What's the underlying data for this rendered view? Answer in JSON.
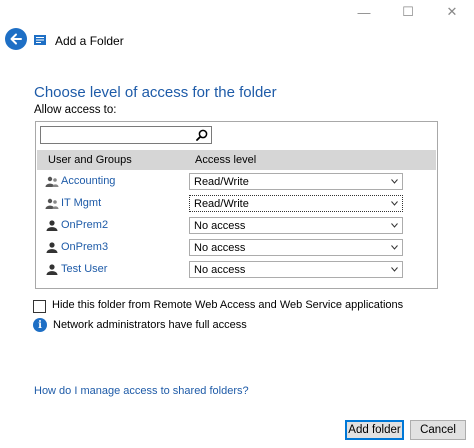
{
  "window": {
    "title": "Add a Folder",
    "controls": {
      "minimize": "—",
      "maximize": "☐",
      "close": "✕"
    }
  },
  "page": {
    "heading": "Choose level of access for the folder",
    "allow_label": "Allow access to:"
  },
  "search": {
    "value": "",
    "placeholder": ""
  },
  "table": {
    "columns": [
      "User and Groups",
      "Access level"
    ],
    "rows": [
      {
        "name": "Accounting",
        "kind": "group",
        "access": "Read/Write"
      },
      {
        "name": "IT Mgmt",
        "kind": "group",
        "access": "Read/Write"
      },
      {
        "name": "OnPrem2",
        "kind": "user",
        "access": "No access"
      },
      {
        "name": "OnPrem3",
        "kind": "user",
        "access": "No access"
      },
      {
        "name": "Test User",
        "kind": "user",
        "access": "No access"
      }
    ]
  },
  "options": {
    "hide_folder_label": "Hide this folder from Remote Web Access and Web Service applications",
    "hide_folder_checked": false,
    "info_text": "Network administrators have full access"
  },
  "help_link": "How do I manage access to shared folders?",
  "buttons": {
    "add": "Add folder",
    "cancel": "Cancel"
  },
  "colors": {
    "accent": "#1e6fc5",
    "link": "#1e5ba8",
    "header_bg": "#d6d6d6"
  }
}
